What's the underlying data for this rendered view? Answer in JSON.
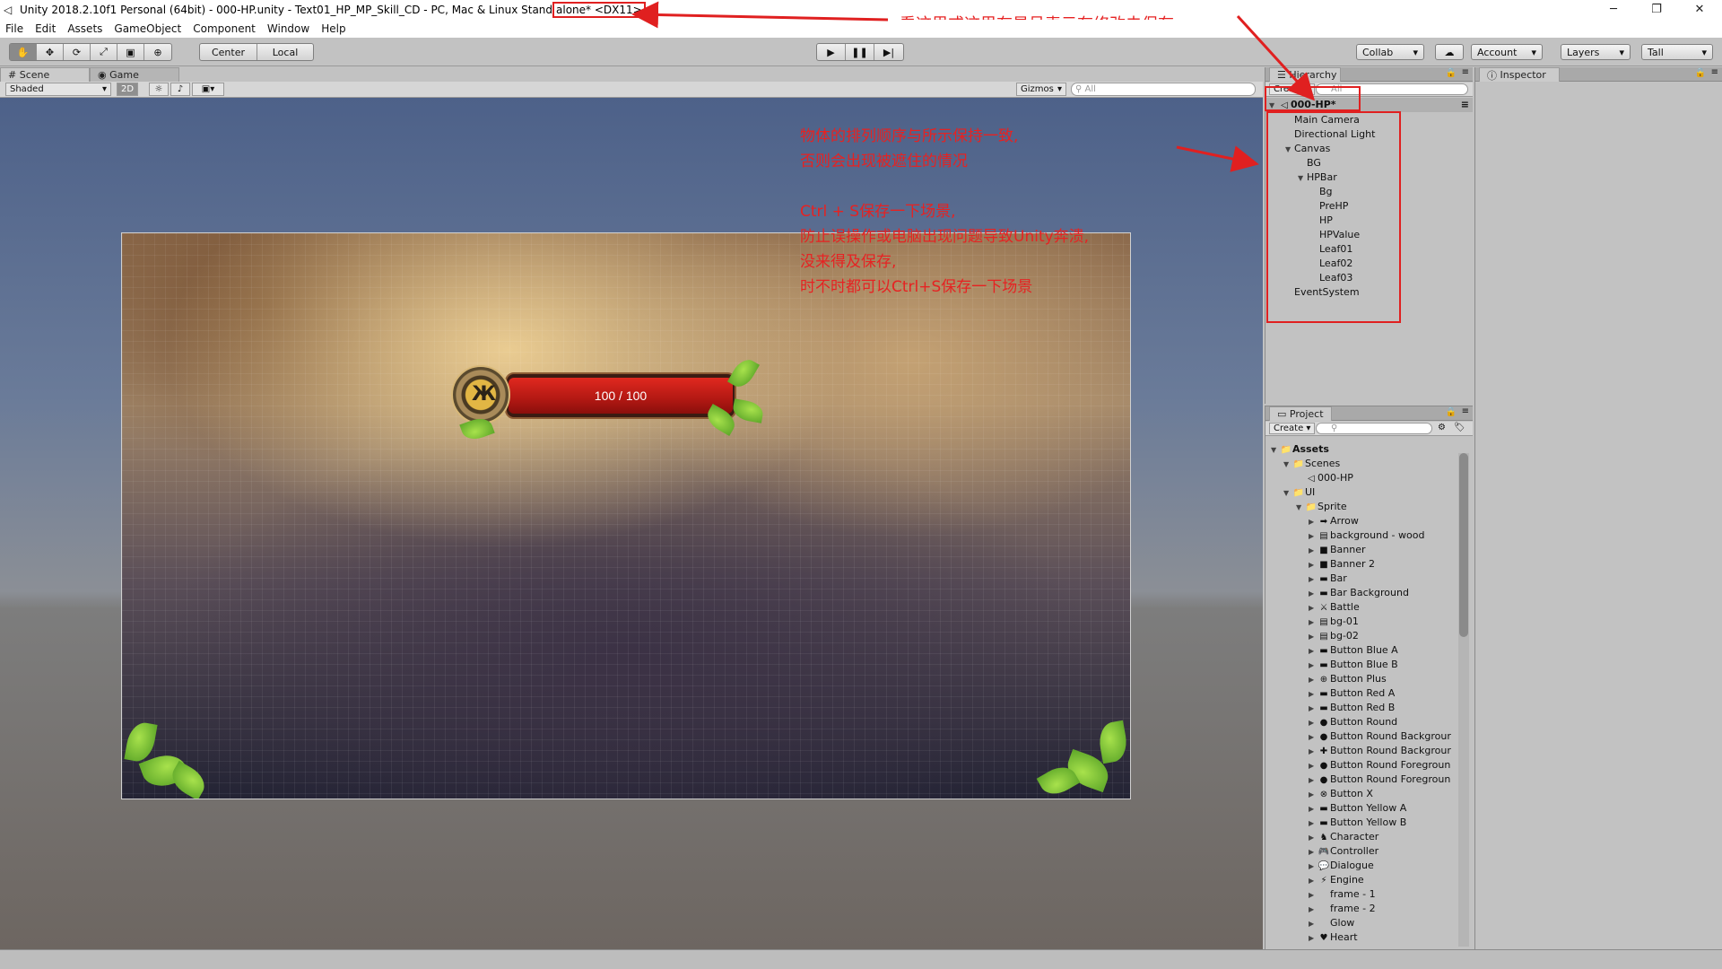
{
  "window": {
    "title_prefix": "Unity 2018.2.10f1 Personal (64bit) - 000-HP.unity - Text01_HP_MP_Skill_CD - PC, Mac & Linux Stand",
    "title_boxed": "alone* <DX11>",
    "minimize": "─",
    "maximize": "❐",
    "close": "✕"
  },
  "menu": [
    "File",
    "Edit",
    "Assets",
    "GameObject",
    "Component",
    "Window",
    "Help"
  ],
  "toolbar": {
    "pivot": "Center",
    "space": "Local",
    "collab": "Collab",
    "account": "Account",
    "layers": "Layers",
    "layout": "Tall"
  },
  "scene": {
    "tab_scene": "Scene",
    "tab_game": "Game",
    "shading": "Shaded",
    "mode_2d": "2D",
    "gizmos": "Gizmos",
    "search_placeholder": "All"
  },
  "game": {
    "hp_value": "100 / 100",
    "hp_fill": 1.0
  },
  "annotations": {
    "top_note": "看这里或这里有星号表示有修改未保存",
    "main_note": "物体的排列顺序与所示保持一致,\n否则会出现被遮住的情况\n\nCtrl + S保存一下场景,\n防止误操作或电脑出现问题导致Unity奔溃,\n没来得及保存,\n时不时都可以Ctrl+S保存一下场景"
  },
  "hierarchy": {
    "tab": "Hierarchy",
    "create": "Create",
    "search_placeholder": "All",
    "scene_name": "000-HP*",
    "items": [
      {
        "label": "Main Camera",
        "level": 1,
        "arrow": ""
      },
      {
        "label": "Directional Light",
        "level": 1,
        "arrow": ""
      },
      {
        "label": "Canvas",
        "level": 1,
        "arrow": "▼"
      },
      {
        "label": "BG",
        "level": 2,
        "arrow": ""
      },
      {
        "label": "HPBar",
        "level": 2,
        "arrow": "▼"
      },
      {
        "label": "Bg",
        "level": 3,
        "arrow": ""
      },
      {
        "label": "PreHP",
        "level": 3,
        "arrow": ""
      },
      {
        "label": "HP",
        "level": 3,
        "arrow": ""
      },
      {
        "label": "HPValue",
        "level": 3,
        "arrow": ""
      },
      {
        "label": "Leaf01",
        "level": 3,
        "arrow": ""
      },
      {
        "label": "Leaf02",
        "level": 3,
        "arrow": ""
      },
      {
        "label": "Leaf03",
        "level": 3,
        "arrow": ""
      },
      {
        "label": "EventSystem",
        "level": 1,
        "arrow": ""
      }
    ]
  },
  "project": {
    "tab": "Project",
    "create": "Create",
    "items": [
      {
        "label": "Assets",
        "level": 0,
        "arrow": "▼",
        "icon": "📁",
        "bold": true
      },
      {
        "label": "Scenes",
        "level": 1,
        "arrow": "▼",
        "icon": "📁"
      },
      {
        "label": "000-HP",
        "level": 2,
        "arrow": "",
        "icon": "◁"
      },
      {
        "label": "UI",
        "level": 1,
        "arrow": "▼",
        "icon": "📁"
      },
      {
        "label": "Sprite",
        "level": 2,
        "arrow": "▼",
        "icon": "📁"
      },
      {
        "label": "Arrow",
        "level": 3,
        "arrow": "▶",
        "icon": "➡"
      },
      {
        "label": "background - wood",
        "level": 3,
        "arrow": "▶",
        "icon": "▤"
      },
      {
        "label": "Banner",
        "level": 3,
        "arrow": "▶",
        "icon": "■"
      },
      {
        "label": "Banner 2",
        "level": 3,
        "arrow": "▶",
        "icon": "■"
      },
      {
        "label": "Bar",
        "level": 3,
        "arrow": "▶",
        "icon": "▬"
      },
      {
        "label": "Bar Background",
        "level": 3,
        "arrow": "▶",
        "icon": "▬"
      },
      {
        "label": "Battle",
        "level": 3,
        "arrow": "▶",
        "icon": "⚔"
      },
      {
        "label": "bg-01",
        "level": 3,
        "arrow": "▶",
        "icon": "▤"
      },
      {
        "label": "bg-02",
        "level": 3,
        "arrow": "▶",
        "icon": "▤"
      },
      {
        "label": "Button Blue A",
        "level": 3,
        "arrow": "▶",
        "icon": "▬"
      },
      {
        "label": "Button Blue B",
        "level": 3,
        "arrow": "▶",
        "icon": "▬"
      },
      {
        "label": "Button Plus",
        "level": 3,
        "arrow": "▶",
        "icon": "⊕"
      },
      {
        "label": "Button Red A",
        "level": 3,
        "arrow": "▶",
        "icon": "▬"
      },
      {
        "label": "Button Red B",
        "level": 3,
        "arrow": "▶",
        "icon": "▬"
      },
      {
        "label": "Button Round",
        "level": 3,
        "arrow": "▶",
        "icon": "●"
      },
      {
        "label": "Button Round Backgrour",
        "level": 3,
        "arrow": "▶",
        "icon": "●"
      },
      {
        "label": "Button Round Backgrour",
        "level": 3,
        "arrow": "▶",
        "icon": "✚"
      },
      {
        "label": "Button Round Foregroun",
        "level": 3,
        "arrow": "▶",
        "icon": "●"
      },
      {
        "label": "Button Round Foregroun",
        "level": 3,
        "arrow": "▶",
        "icon": "●"
      },
      {
        "label": "Button X",
        "level": 3,
        "arrow": "▶",
        "icon": "⊗"
      },
      {
        "label": "Button Yellow A",
        "level": 3,
        "arrow": "▶",
        "icon": "▬"
      },
      {
        "label": "Button Yellow B",
        "level": 3,
        "arrow": "▶",
        "icon": "▬"
      },
      {
        "label": "Character",
        "level": 3,
        "arrow": "▶",
        "icon": "♞"
      },
      {
        "label": "Controller",
        "level": 3,
        "arrow": "▶",
        "icon": "🎮"
      },
      {
        "label": "Dialogue",
        "level": 3,
        "arrow": "▶",
        "icon": "💬"
      },
      {
        "label": "Engine",
        "level": 3,
        "arrow": "▶",
        "icon": "⚡"
      },
      {
        "label": "frame - 1",
        "level": 3,
        "arrow": "▶",
        "icon": ""
      },
      {
        "label": "frame - 2",
        "level": 3,
        "arrow": "▶",
        "icon": ""
      },
      {
        "label": "Glow",
        "level": 3,
        "arrow": "▶",
        "icon": ""
      },
      {
        "label": "Heart",
        "level": 3,
        "arrow": "▶",
        "icon": "♥"
      }
    ]
  },
  "inspector": {
    "tab": "Inspector"
  },
  "colors": {
    "annotation": "#e62222",
    "panel": "#c2c2c2",
    "hp_fill": "#c81e18"
  }
}
